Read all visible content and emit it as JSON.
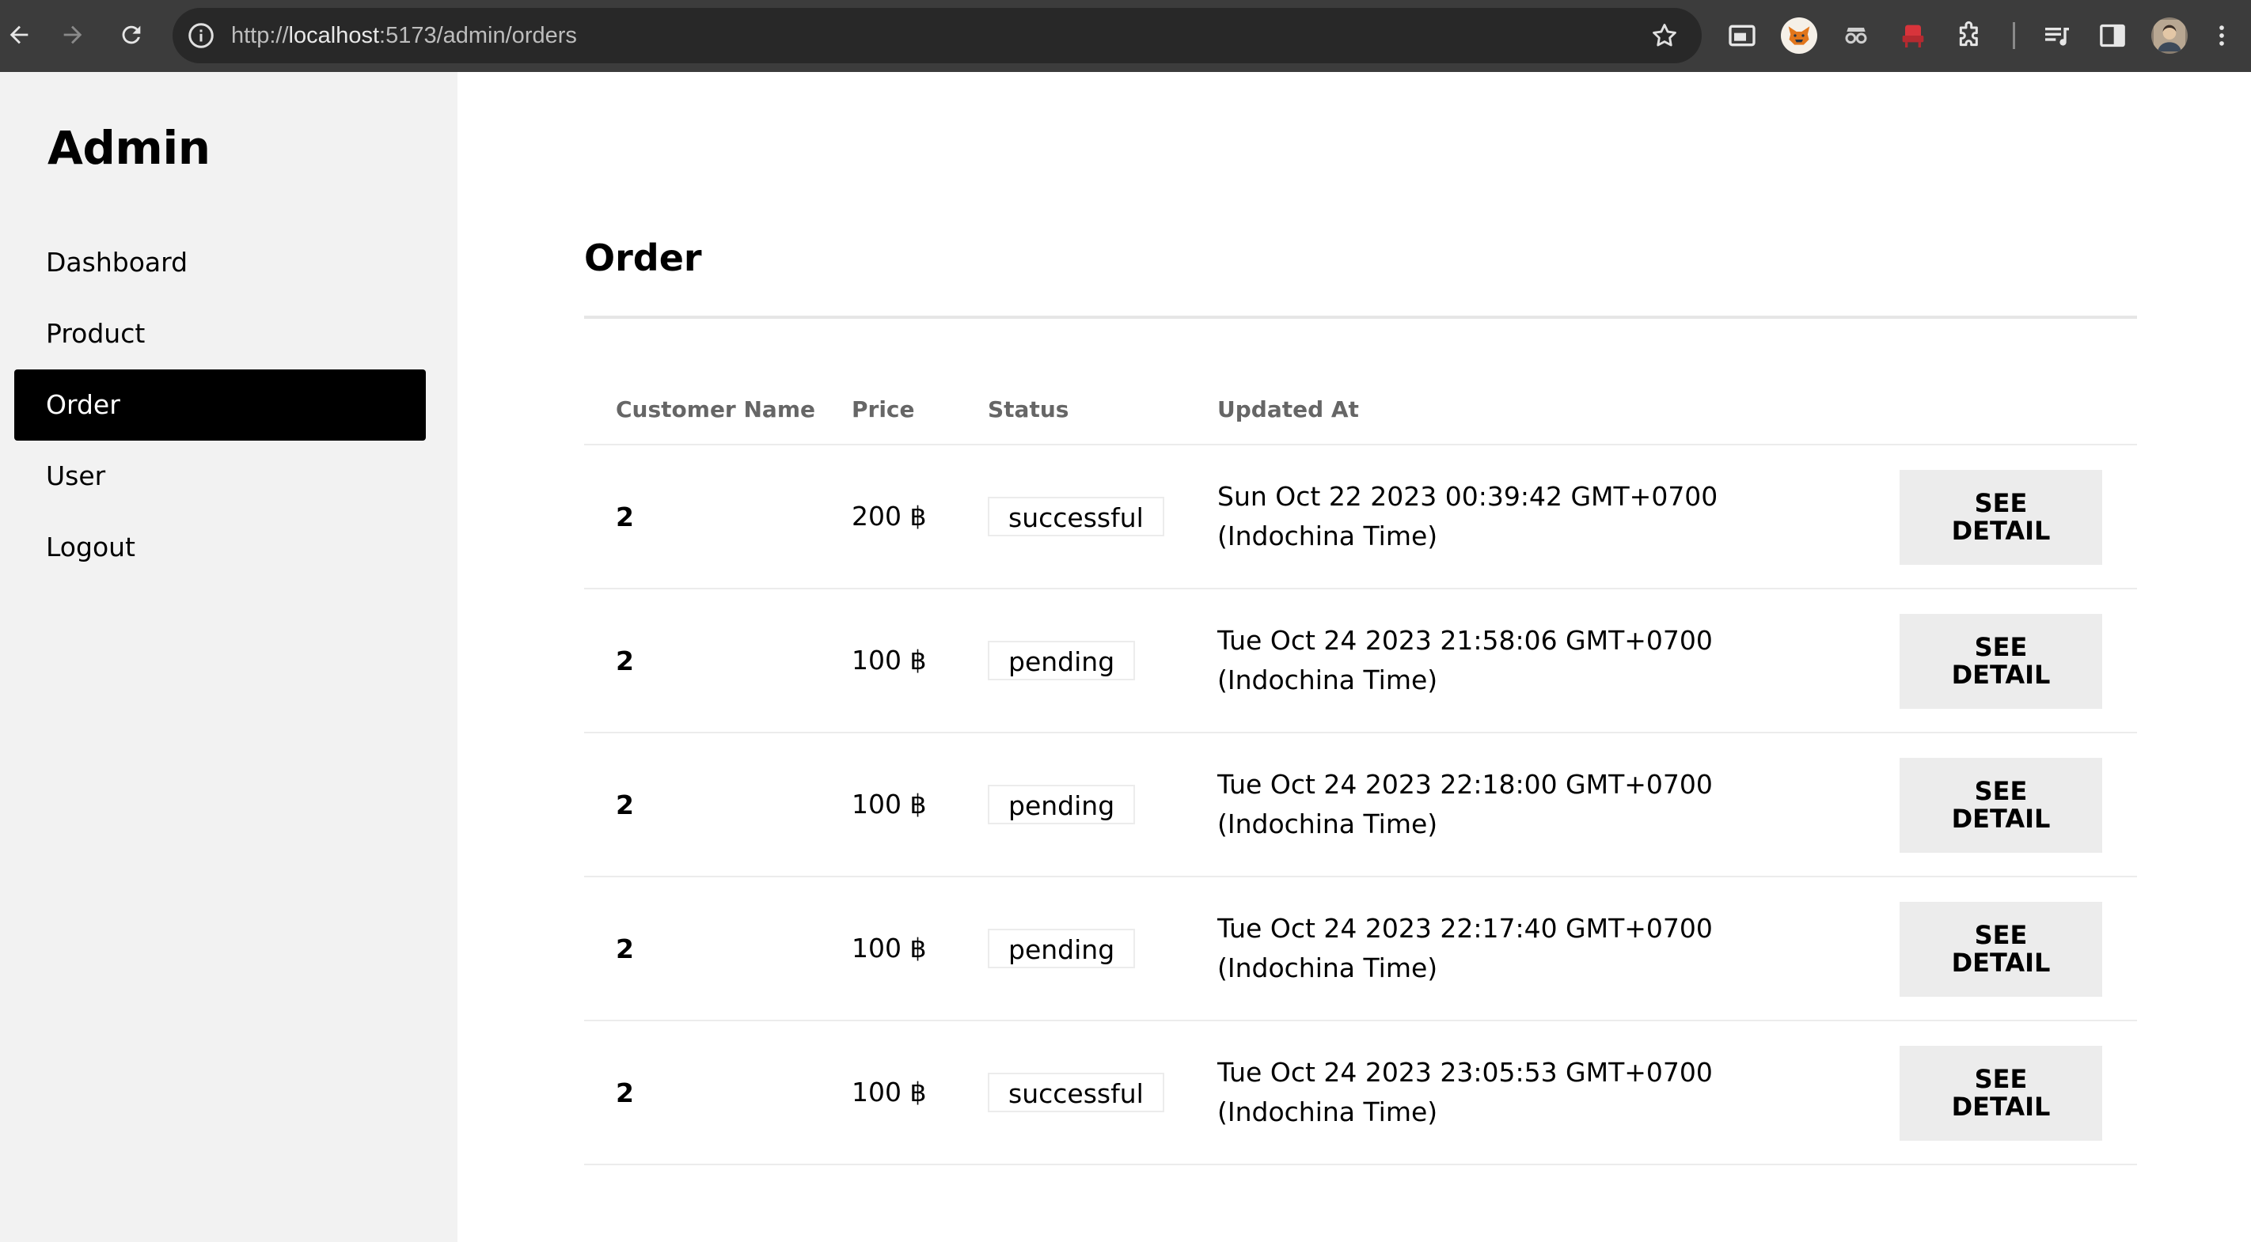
{
  "browser": {
    "url_prefix": "http://",
    "url_host": "localhost",
    "url_path": ":5173/admin/orders"
  },
  "sidebar": {
    "brand": "Admin",
    "items": [
      {
        "label": "Dashboard",
        "active": false
      },
      {
        "label": "Product",
        "active": false
      },
      {
        "label": "Order",
        "active": true
      },
      {
        "label": "User",
        "active": false
      },
      {
        "label": "Logout",
        "active": false
      }
    ]
  },
  "page": {
    "title": "Order"
  },
  "table": {
    "headers": {
      "customer_name": "Customer Name",
      "price": "Price",
      "status": "Status",
      "updated_at": "Updated At"
    },
    "rows": [
      {
        "customer": "2",
        "price": "200 ฿",
        "status": "successful",
        "updated_at": "Sun Oct 22 2023 00:39:42 GMT+0700 (Indochina Time)",
        "action": "SEE DETAIL"
      },
      {
        "customer": "2",
        "price": "100 ฿",
        "status": "pending",
        "updated_at": "Tue Oct 24 2023 21:58:06 GMT+0700 (Indochina Time)",
        "action": "SEE DETAIL"
      },
      {
        "customer": "2",
        "price": "100 ฿",
        "status": "pending",
        "updated_at": "Tue Oct 24 2023 22:18:00 GMT+0700 (Indochina Time)",
        "action": "SEE DETAIL"
      },
      {
        "customer": "2",
        "price": "100 ฿",
        "status": "pending",
        "updated_at": "Tue Oct 24 2023 22:17:40 GMT+0700 (Indochina Time)",
        "action": "SEE DETAIL"
      },
      {
        "customer": "2",
        "price": "100 ฿",
        "status": "successful",
        "updated_at": "Tue Oct 24 2023 23:05:53 GMT+0700 (Indochina Time)",
        "action": "SEE DETAIL"
      }
    ]
  },
  "colors": {
    "chrome": "#3c3c3c",
    "sidebar_bg": "#f2f2f2",
    "active_item_bg": "#000000",
    "button_bg": "#ececec"
  }
}
